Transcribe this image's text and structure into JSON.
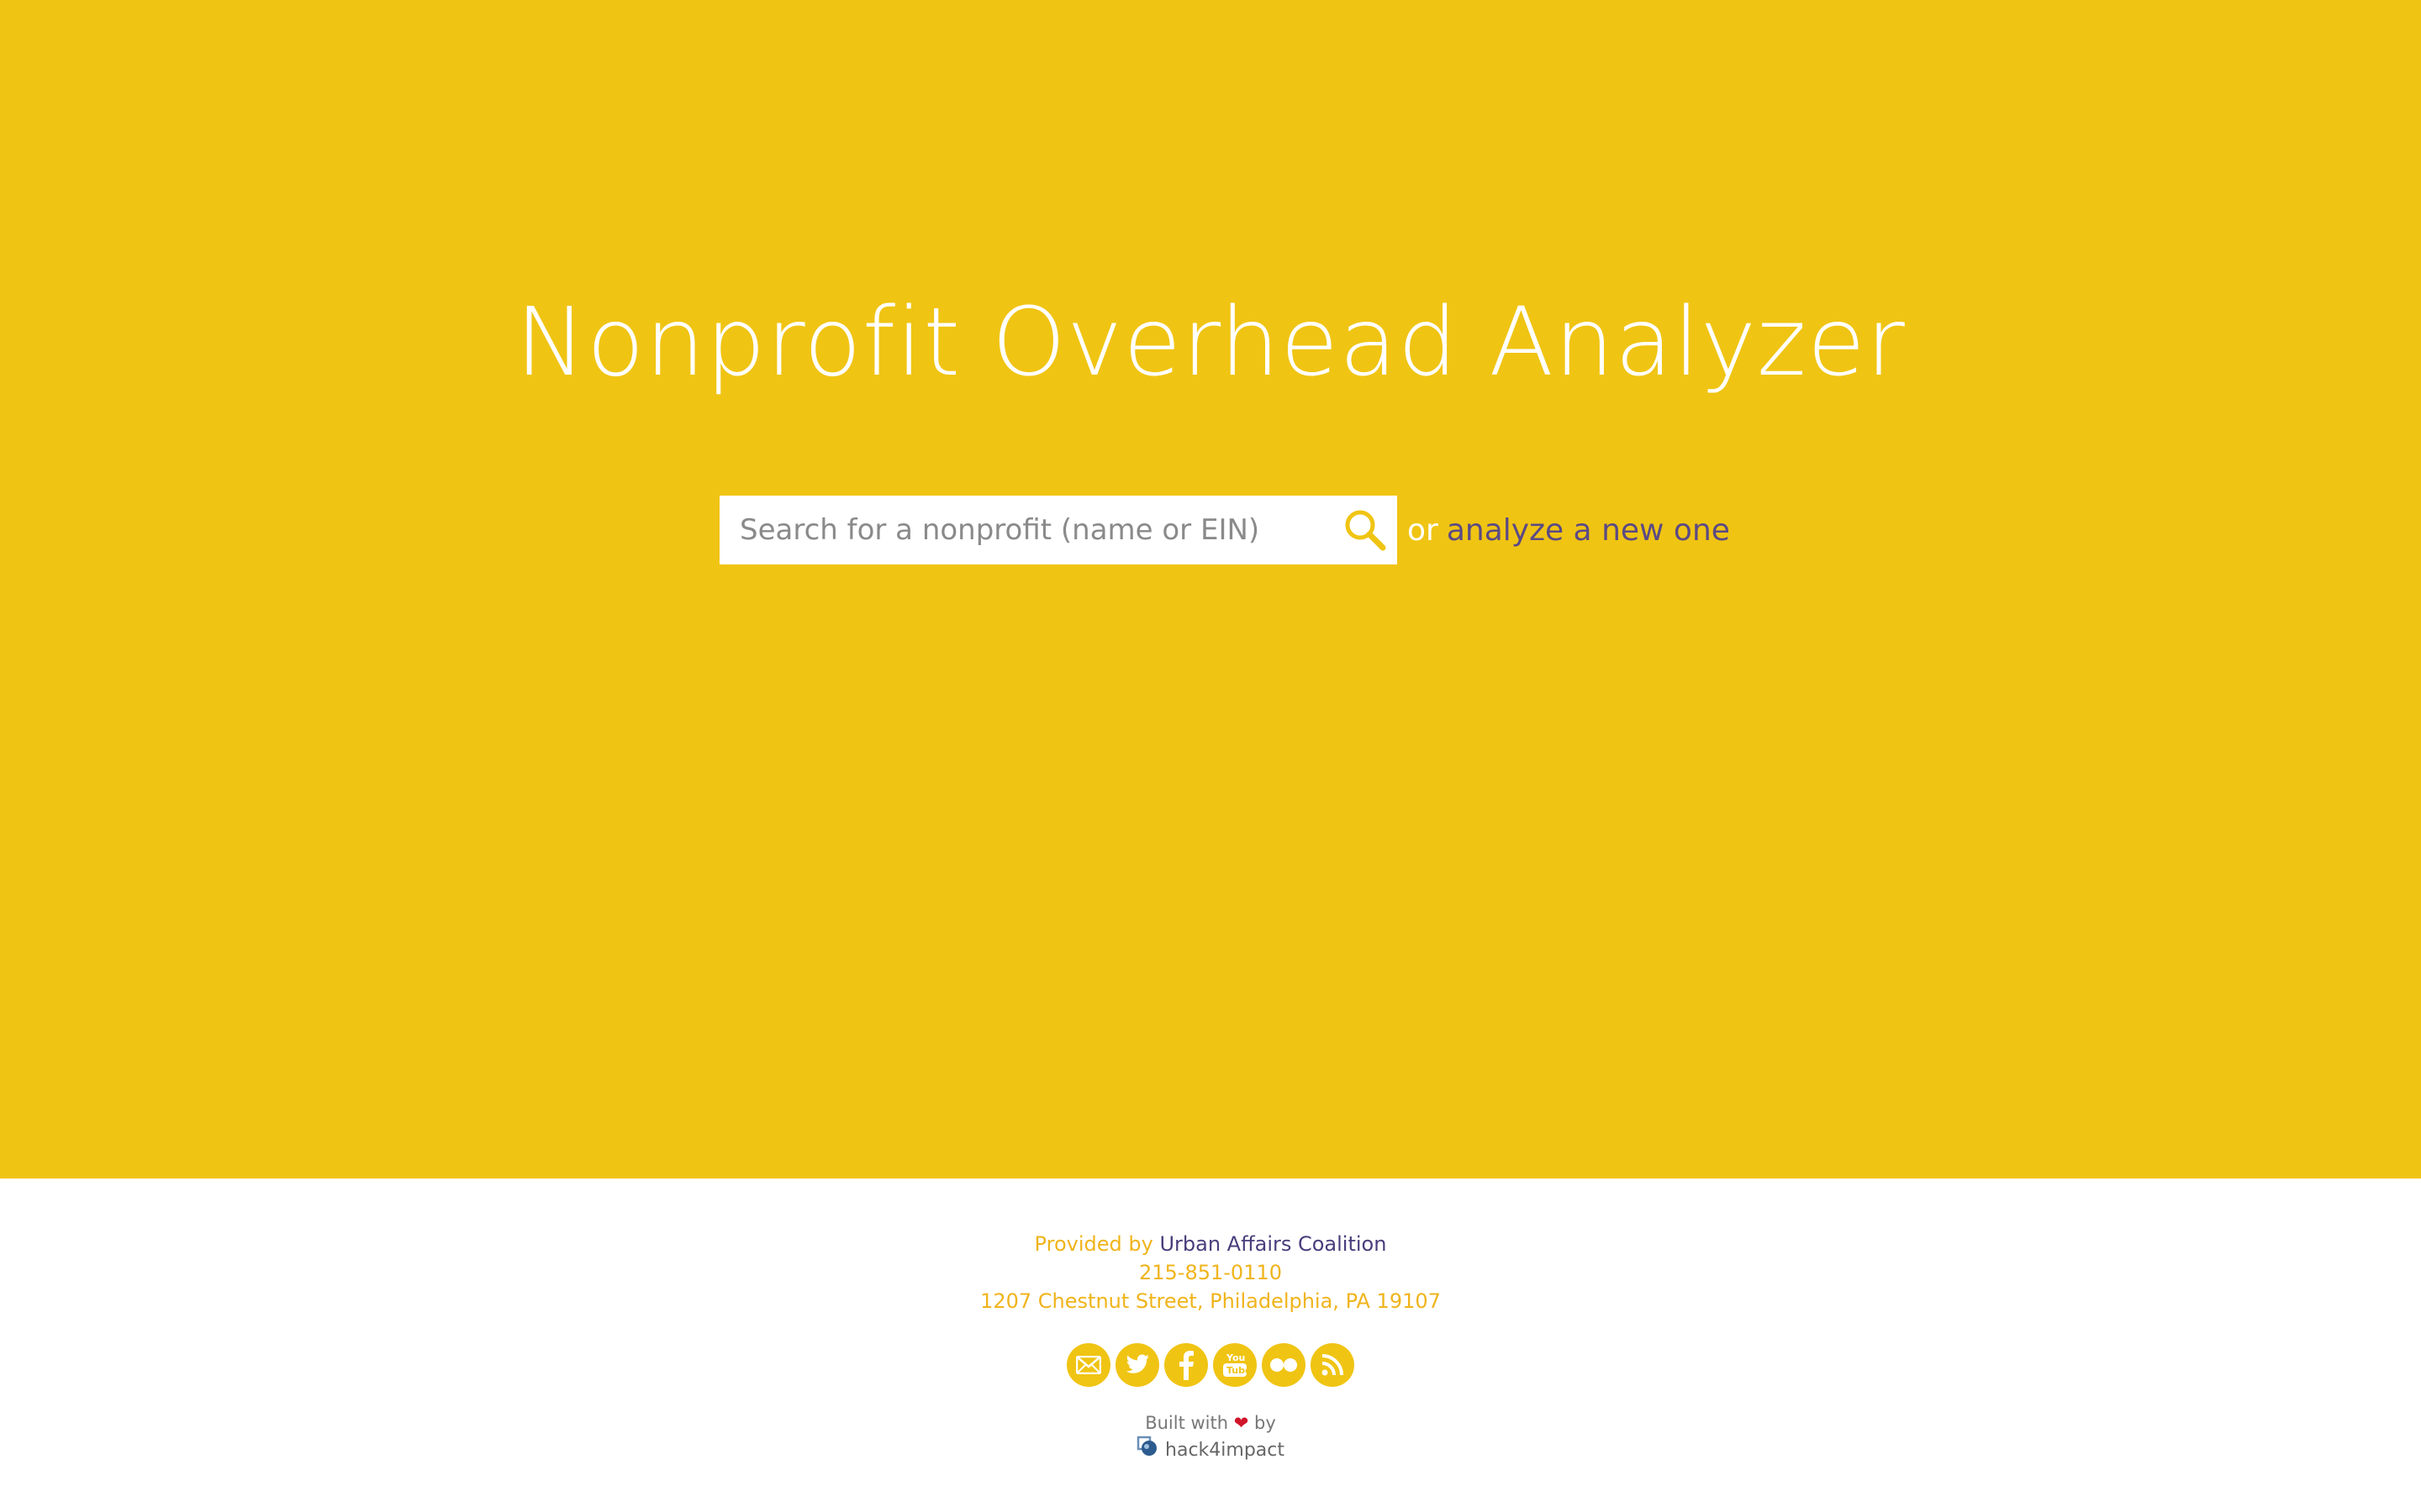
{
  "header": {
    "title": "Nonprofit Overhead Analyzer"
  },
  "search": {
    "placeholder": "Search for a nonprofit (name or EIN)",
    "icon": "search-icon",
    "or_text": "or",
    "new_link": "analyze a new one"
  },
  "footer": {
    "provided_prefix": "Provided by",
    "provider_name": "Urban Affairs Coalition",
    "phone": "215-851-0110",
    "address": "1207 Chestnut Street, Philadelphia, PA 19107",
    "social_icons": [
      "email-icon",
      "twitter-icon",
      "facebook-icon",
      "youtube-icon",
      "flickr-icon",
      "rss-icon"
    ],
    "built_prefix": "Built with",
    "built_suffix": "by",
    "builder": "hack4impact"
  },
  "colors": {
    "accent": "#f0c413",
    "link": "#5b4a84",
    "footer_text": "#f0b41b"
  }
}
